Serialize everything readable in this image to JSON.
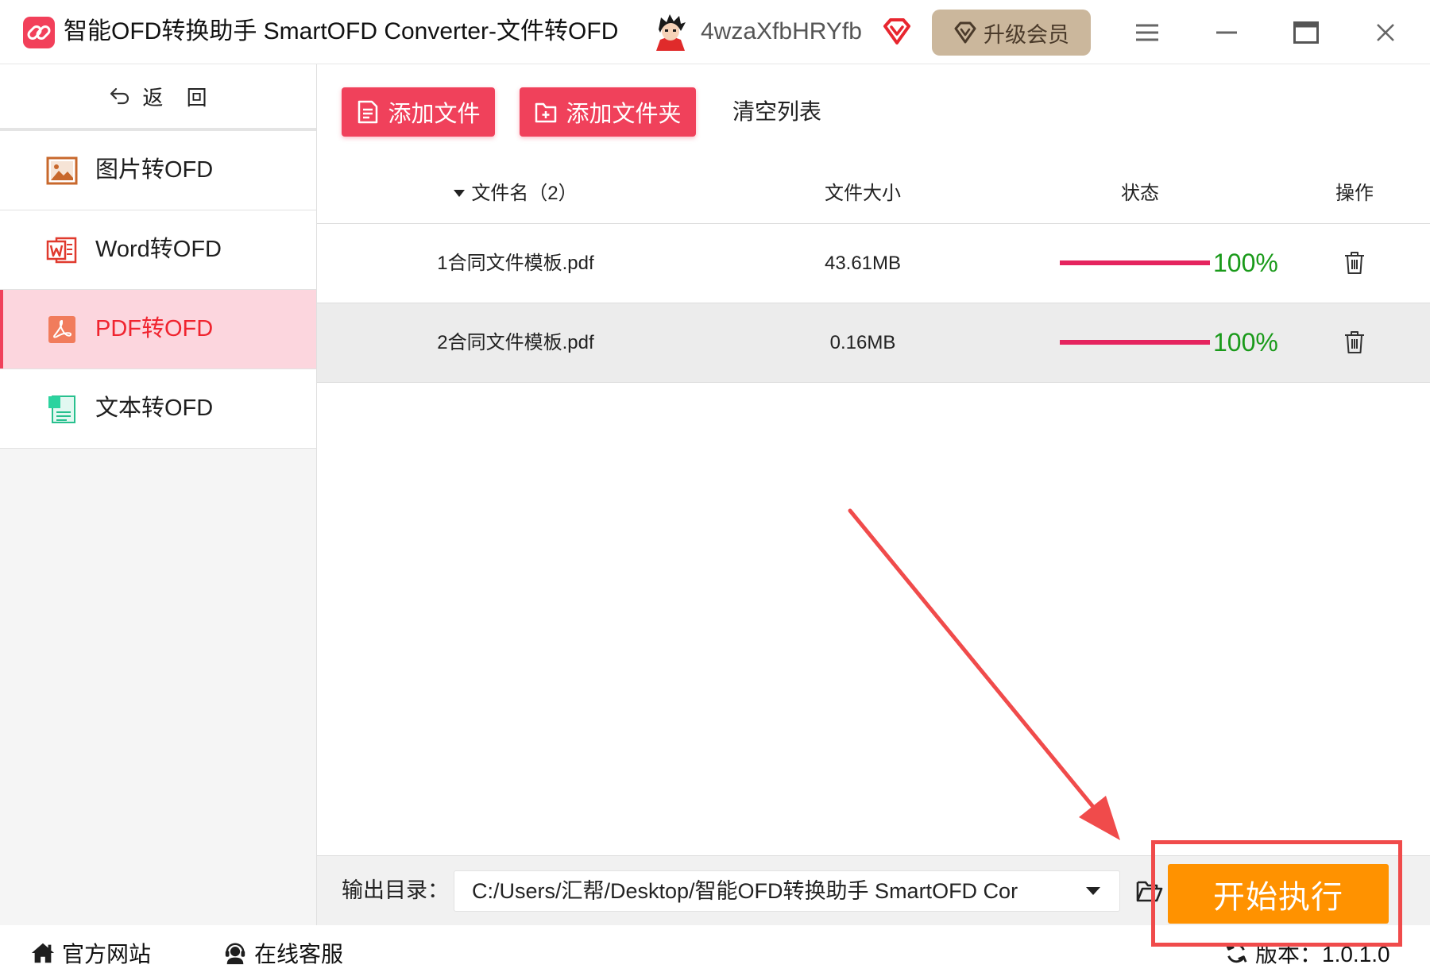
{
  "window": {
    "title": "智能OFD转换助手 SmartOFD Converter-文件转OFD",
    "username": "4wzaXfbHRYfb",
    "upgrade_label": "升级会员"
  },
  "sidebar": {
    "back_label": "返 回",
    "items": [
      {
        "label": "图片转OFD",
        "icon": "image-icon",
        "active": false
      },
      {
        "label": "Word转OFD",
        "icon": "word-icon",
        "active": false
      },
      {
        "label": "PDF转OFD",
        "icon": "pdf-icon",
        "active": true
      },
      {
        "label": "文本转OFD",
        "icon": "text-file-icon",
        "active": false
      }
    ]
  },
  "toolbar": {
    "add_file_label": "添加文件",
    "add_folder_label": "添加文件夹",
    "clear_list_label": "清空列表"
  },
  "table": {
    "columns": {
      "name": "文件名（2）",
      "size": "文件大小",
      "status": "状态",
      "action": "操作"
    },
    "rows": [
      {
        "name": "1合同文件模板.pdf",
        "size": "43.61MB",
        "progress": 1.0,
        "status_text": "100%",
        "selected": false
      },
      {
        "name": "2合同文件模板.pdf",
        "size": "0.16MB",
        "progress": 1.0,
        "status_text": "100%",
        "selected": true
      }
    ]
  },
  "output": {
    "label": "输出目录：",
    "path": "C:/Users/汇帮/Desktop/智能OFD转换助手 SmartOFD Cor"
  },
  "start_label": "开始执行",
  "footer": {
    "website_label": "官方网站",
    "support_label": "在线客服",
    "version_label": "版本：1.0.1.0"
  },
  "colors": {
    "accent": "#f0415b",
    "active_bg": "#fcd6de",
    "active_text": "#f0242f",
    "progress": "#e5245f",
    "status_ok": "#1a9a1a",
    "start": "#ff9200",
    "upgrade_bg": "#cbb79c",
    "annotation": "#f04b4b"
  }
}
